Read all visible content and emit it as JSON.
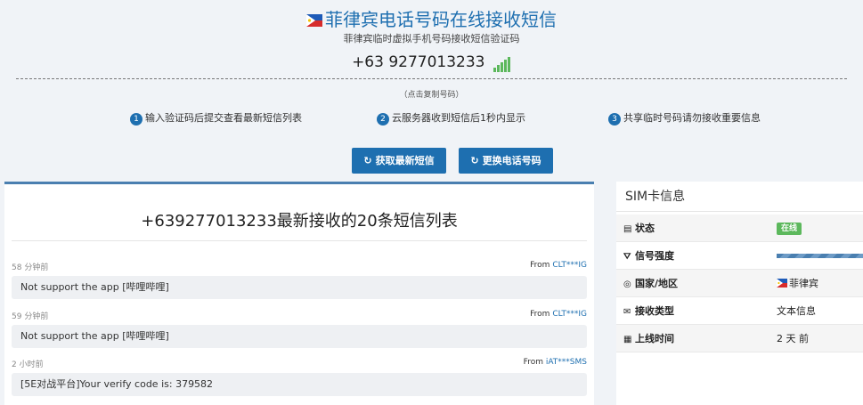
{
  "header": {
    "title": "菲律宾电话号码在线接收短信",
    "subtitle": "菲律宾临时虚拟手机号码接收短信验证码",
    "phone": "+63 9277013233",
    "copy_hint": "（点击复制号码）"
  },
  "steps": [
    {
      "num": "1",
      "label": "输入验证码后提交查看最新短信列表"
    },
    {
      "num": "2",
      "label": "云服务器收到短信后1秒内显示"
    },
    {
      "num": "3",
      "label": "共享临时号码请勿接收重要信息"
    }
  ],
  "buttons": {
    "refresh_icon": "↻",
    "refresh_label": "获取最新短信",
    "change_icon": "↻",
    "change_label": "更换电话号码"
  },
  "list": {
    "title": "+639277013233最新接收的20条短信列表",
    "messages": [
      {
        "time": "58 分钟前",
        "from_prefix": "From ",
        "sender": "CLT***IG",
        "body": "Not support the app [哔哩哔哩]"
      },
      {
        "time": "59 分钟前",
        "from_prefix": "From ",
        "sender": "CLT***IG",
        "body": "Not support the app [哔哩哔哩]"
      },
      {
        "time": "2 小时前",
        "from_prefix": "From ",
        "sender": "iAT***SMS",
        "body": "[5E对战平台]Your verify code is: 379582"
      }
    ]
  },
  "sim": {
    "heading": "SIM卡信息",
    "rows": {
      "status": {
        "icon": "▤",
        "label": "状态",
        "value": "在线"
      },
      "signal": {
        "icon": "⛛",
        "label": "信号强度",
        "value_pct": 100
      },
      "country": {
        "icon": "◎",
        "label": "国家/地区",
        "value": "菲律宾"
      },
      "type": {
        "icon": "✉",
        "label": "接收类型",
        "value": "文本信息"
      },
      "online": {
        "icon": "▦",
        "label": "上线时间",
        "value": "2 天 前"
      }
    }
  },
  "colors": {
    "accent": "#1e6fb0",
    "online": "#5cb85c",
    "signal": "#5cb85c"
  }
}
